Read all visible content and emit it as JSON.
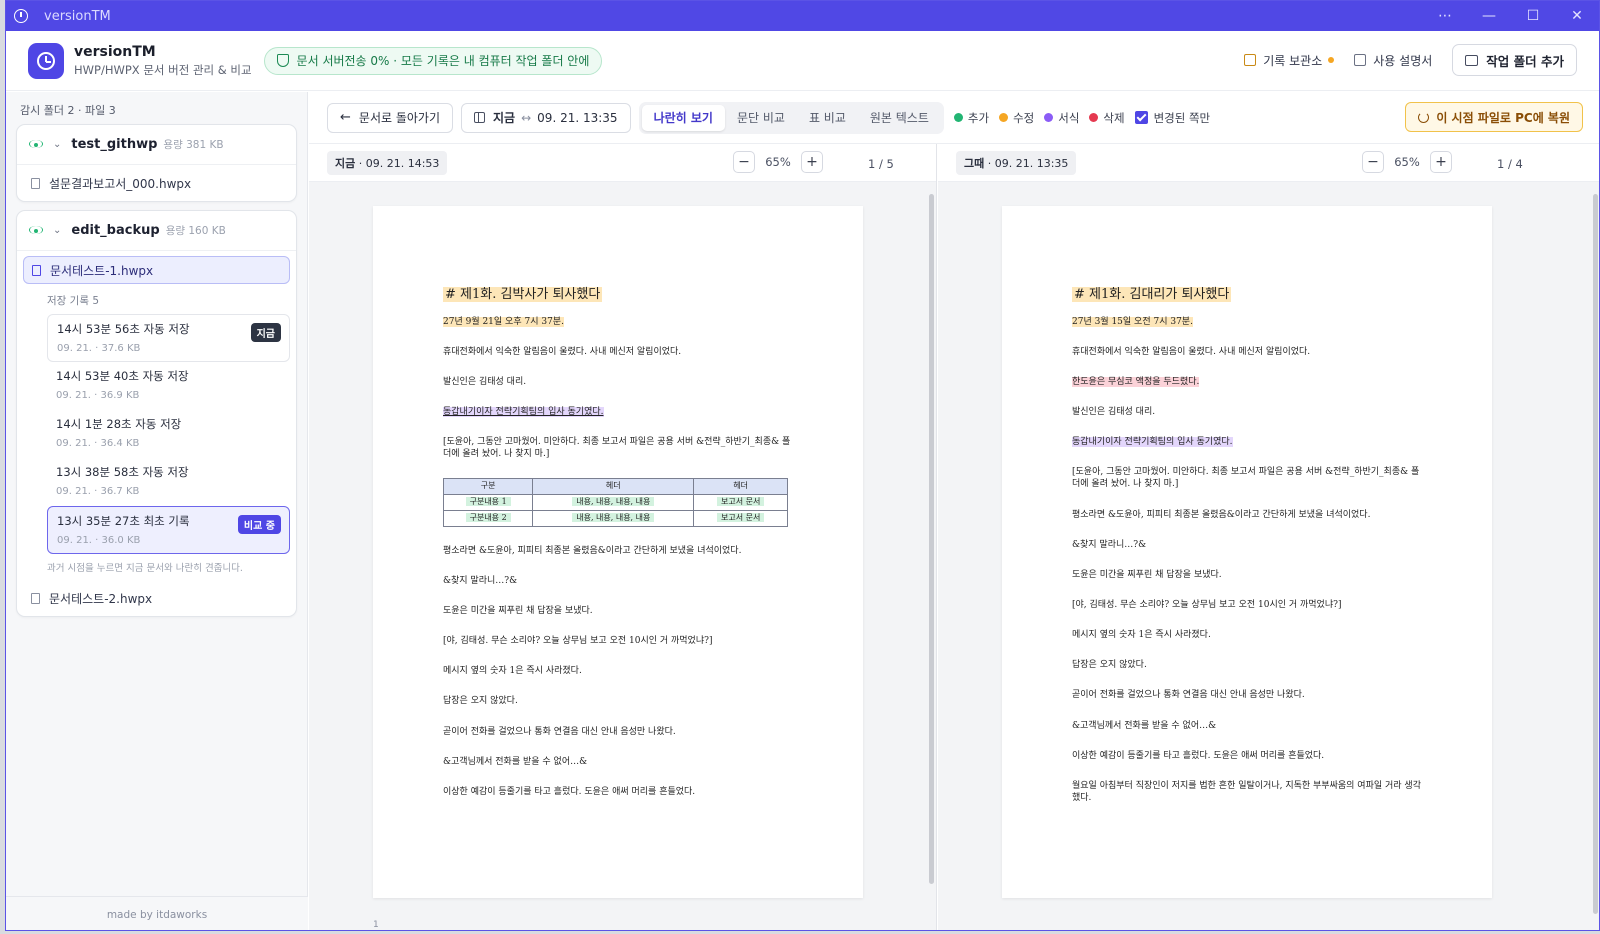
{
  "window": {
    "title": "versionTM"
  },
  "header": {
    "app_name": "versionTM",
    "app_sub": "HWP/HWPX 문서 버전 관리 & 비교",
    "privacy_badge": "문서 서버전송 0% · 모든 기록은 내 컴퓨터 작업 폴더 안에",
    "archive_label": "기록 보관소",
    "manual_label": "사용 설명서",
    "add_folder_label": "작업 폴더 추가"
  },
  "sidebar": {
    "summary": "감시 폴더 2 · 파일 3",
    "folders": [
      {
        "name": "test_githwp",
        "size": "용량 381 KB",
        "files": [
          "설문결과보고서_000.hwpx"
        ]
      },
      {
        "name": "edit_backup",
        "size": "용량 160 KB",
        "files": [
          "문서테스트-1.hwpx",
          "문서테스트-2.hwpx"
        ]
      }
    ],
    "history_head": "저장 기록 5",
    "history": [
      {
        "title": "14시 53분 56초 자동 저장",
        "meta": "09. 21. · 37.6 KB",
        "badge": "지금"
      },
      {
        "title": "14시 53분 40초 자동 저장",
        "meta": "09. 21. · 36.9 KB"
      },
      {
        "title": "14시 1분 28초 자동 저장",
        "meta": "09. 21. · 36.4 KB"
      },
      {
        "title": "13시 38분 58초 자동 저장",
        "meta": "09. 21. · 36.7 KB"
      },
      {
        "title": "13시 35분 27초 최초 기록",
        "meta": "09. 21. · 36.0 KB",
        "badge": "비교 중"
      }
    ],
    "hint": "과거 시점을 누르면 지금 문서와 나란히 견줍니다.",
    "footer": "made by itdaworks"
  },
  "toolbar": {
    "back_label": "문서로 돌아가기",
    "range_now": "지금",
    "range_sep": "↔",
    "range_then": "09. 21. 13:35",
    "modes": [
      "나란히 보기",
      "문단 비교",
      "표 비교",
      "원본 텍스트"
    ],
    "legend": [
      {
        "label": "추가",
        "color": "#22b573"
      },
      {
        "label": "수정",
        "color": "#f5a623"
      },
      {
        "label": "서식",
        "color": "#8b5cf6"
      },
      {
        "label": "삭제",
        "color": "#e53950"
      }
    ],
    "changed_only": "변경된 쪽만",
    "restore_label": "이 시점 파일로 PC에 복원"
  },
  "left_pane": {
    "tag_bold": "지금",
    "tag_rest": " · 09. 21. 14:53",
    "zoom": "65%",
    "page": "1 / 5",
    "footer_page": "1",
    "heading": "# 제1화. 김박사가 퇴사했다",
    "date": "27년 9월 21일 오후 7시 37분.",
    "p1": "휴대전화에서 익숙한 알림음이 울렸다. 사내 메신저 알림이었다.",
    "p2": "발신인은 김태성 대리.",
    "p3": "동갑내기이자 전략기획팀의 입사 동기였다.",
    "p4": "[도윤아, 그동안 고마웠어. 미안하다. 최종 보고서 파일은 공용 서버 &전략_하반기_최종& 폴더에 올려 놨어. 나 찾지 마.]",
    "table": {
      "headers": [
        "구분",
        "헤더",
        "헤더"
      ],
      "rows": [
        [
          "구분내용 1",
          "내용, 내용, 내용, 내용",
          "보고서 문서"
        ],
        [
          "구분내용 2",
          "내용, 내용, 내용, 내용",
          "보고서 문서"
        ]
      ]
    },
    "p5": "평소라면 &도윤아, 피피티 최종본 올렸음&이라고 간단하게 보냈을 녀석이었다.",
    "p6": "&찾지 말라니…?&",
    "p7": "도윤은 미간을 찌푸린 채 답장을 보냈다.",
    "p8": "[야, 김태성. 무슨 소리야? 오늘 상무님 보고 오전 10시인 거 까먹었냐?]",
    "p9": "메시지 옆의 숫자 1은 즉시 사라졌다.",
    "p10": "답장은 오지 않았다.",
    "p11": "곧이어 전화를 걸었으나 통화 연결음 대신 안내 음성만 나왔다.",
    "p12": "&고객님께서 전화를 받을 수 없어…&",
    "p13": "이상한 예감이 등줄기를 타고 흘렀다. 도윤은 애써 머리를 흔들었다."
  },
  "right_pane": {
    "tag_bold": "그때",
    "tag_rest": " · 09. 21. 13:35",
    "zoom": "65%",
    "page": "1 / 4",
    "heading": "# 제1화. 김대리가 퇴사했다",
    "date": "27년 3월 15일 오전 7시 37분.",
    "p1": "휴대전화에서 익숙한 알림음이 울렸다. 사내 메신저 알림이었다.",
    "p2": "한도윤은 무심코 액정을 두드렸다.",
    "p3": "발신인은 김태성 대리.",
    "p4": "동갑내기이자 전략기획팀의 입사 동기였다.",
    "p5": "[도윤아, 그동안 고마웠어. 미안하다. 최종 보고서 파일은 공용 서버 &전략_하반기_최종& 폴더에 올려 놨어. 나 찾지 마.]",
    "p6": "평소라면 &도윤아, 피피티 최종본 올렸음&이라고 간단하게 보냈을 녀석이었다.",
    "p7": "&찾지 말라니…?&",
    "p8": "도윤은 미간을 찌푸린 채 답장을 보냈다.",
    "p9": "[야, 김태성. 무슨 소리야? 오늘 상무님 보고 오전 10시인 거 까먹었냐?]",
    "p10": "메시지 옆의 숫자 1은 즉시 사라졌다.",
    "p11": "답장은 오지 않았다.",
    "p12": "곧이어 전화를 걸었으나 통화 연결음 대신 안내 음성만 나왔다.",
    "p13": "&고객님께서 전화를 받을 수 없어…&",
    "p14": "이상한 예감이 등줄기를 타고 흘렀다. 도윤은 애써 머리를 흔들었다.",
    "p15": "월요일 아침부터 직장인이 저지를 법한 흔한 일탈이거나, 지독한 부부싸움의 여파일 거라 생각했다."
  }
}
